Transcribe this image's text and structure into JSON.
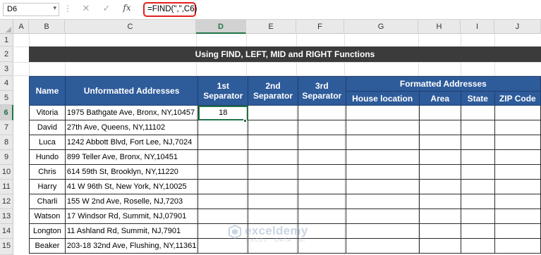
{
  "formula_bar": {
    "name_box": "D6",
    "formula": "=FIND(\",\",C6)",
    "icons": [
      "cancel-icon",
      "enter-icon",
      "fx-icon"
    ]
  },
  "columns": [
    "A",
    "B",
    "C",
    "D",
    "E",
    "F",
    "G",
    "H",
    "I",
    "J"
  ],
  "selected_column": "D",
  "rows": [
    "1",
    "2",
    "3",
    "4",
    "5",
    "6",
    "7",
    "8",
    "9",
    "10",
    "11",
    "12",
    "13",
    "14",
    "15"
  ],
  "selected_row": "6",
  "title": "Using FIND, LEFT, MID and RIGHT Functions",
  "table": {
    "headers": {
      "name": "Name",
      "unformatted": "Unformatted Addresses",
      "sep1": "1st Separator",
      "sep2": "2nd Separator",
      "sep3": "3rd Separator",
      "formatted": "Formatted Addresses",
      "house": "House location",
      "area": "Area",
      "state": "State",
      "zip": "ZIP Code"
    },
    "rows": [
      {
        "name": "Vitoria",
        "address": "1975 Bathgate Ave, Bronx, NY,10457",
        "sep1": "18"
      },
      {
        "name": "David",
        "address": "27th Ave, Queens, NY,11102",
        "sep1": ""
      },
      {
        "name": "Luca",
        "address": "1242 Abbott Blvd, Fort Lee, NJ,7024",
        "sep1": ""
      },
      {
        "name": "Hundo",
        "address": "899 Teller Ave, Bronx, NY,10451",
        "sep1": ""
      },
      {
        "name": "Chris",
        "address": "614 59th St, Brooklyn, NY,11220",
        "sep1": ""
      },
      {
        "name": "Harry",
        "address": "41 W 96th St, New York, NY,10025",
        "sep1": ""
      },
      {
        "name": "Charli",
        "address": "155 W 2nd Ave, Roselle, NJ,7203",
        "sep1": ""
      },
      {
        "name": "Watson",
        "address": "17 Windsor Rd, Summit, NJ,07901",
        "sep1": ""
      },
      {
        "name": "Longton",
        "address": "11 Ashland Rd, Summit, NJ,7901",
        "sep1": ""
      },
      {
        "name": "Beaker",
        "address": "203-18 32nd Ave, Flushing, NY,11361",
        "sep1": ""
      }
    ]
  },
  "watermark": {
    "brand": "exceldemy",
    "tagline": "EXCEL · DATA · BI"
  },
  "colors": {
    "header_blue": "#2e5b9a",
    "title_dark": "#3b3b3b",
    "excel_green": "#217346",
    "formula_highlight": "#e32020"
  }
}
